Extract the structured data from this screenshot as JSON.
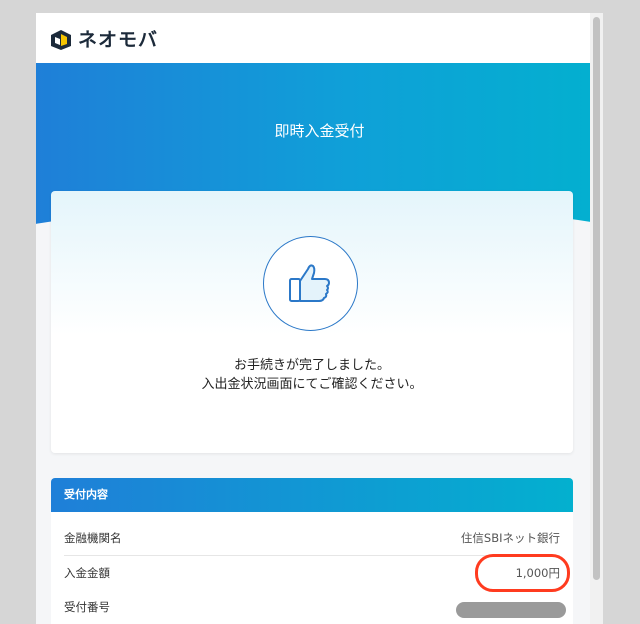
{
  "header": {
    "brand_name": "ネオモバ",
    "logo_icon": "neomoba-logo-icon"
  },
  "hero": {
    "title": "即時入金受付"
  },
  "completion": {
    "icon": "thumbs-up-icon",
    "message_line1": "お手続きが完了しました。",
    "message_line2": "入出金状況画面にてご確認ください。"
  },
  "receipt": {
    "heading": "受付内容",
    "rows": [
      {
        "label": "金融機関名",
        "value": "住信SBIネット銀行"
      },
      {
        "label": "入金金額",
        "value": "1,000円"
      },
      {
        "label": "受付番号",
        "value": ""
      }
    ]
  },
  "colors": {
    "accent_blue": "#1f7fd8",
    "accent_cyan": "#03b0cf",
    "highlight_red": "#ff3b1f"
  }
}
